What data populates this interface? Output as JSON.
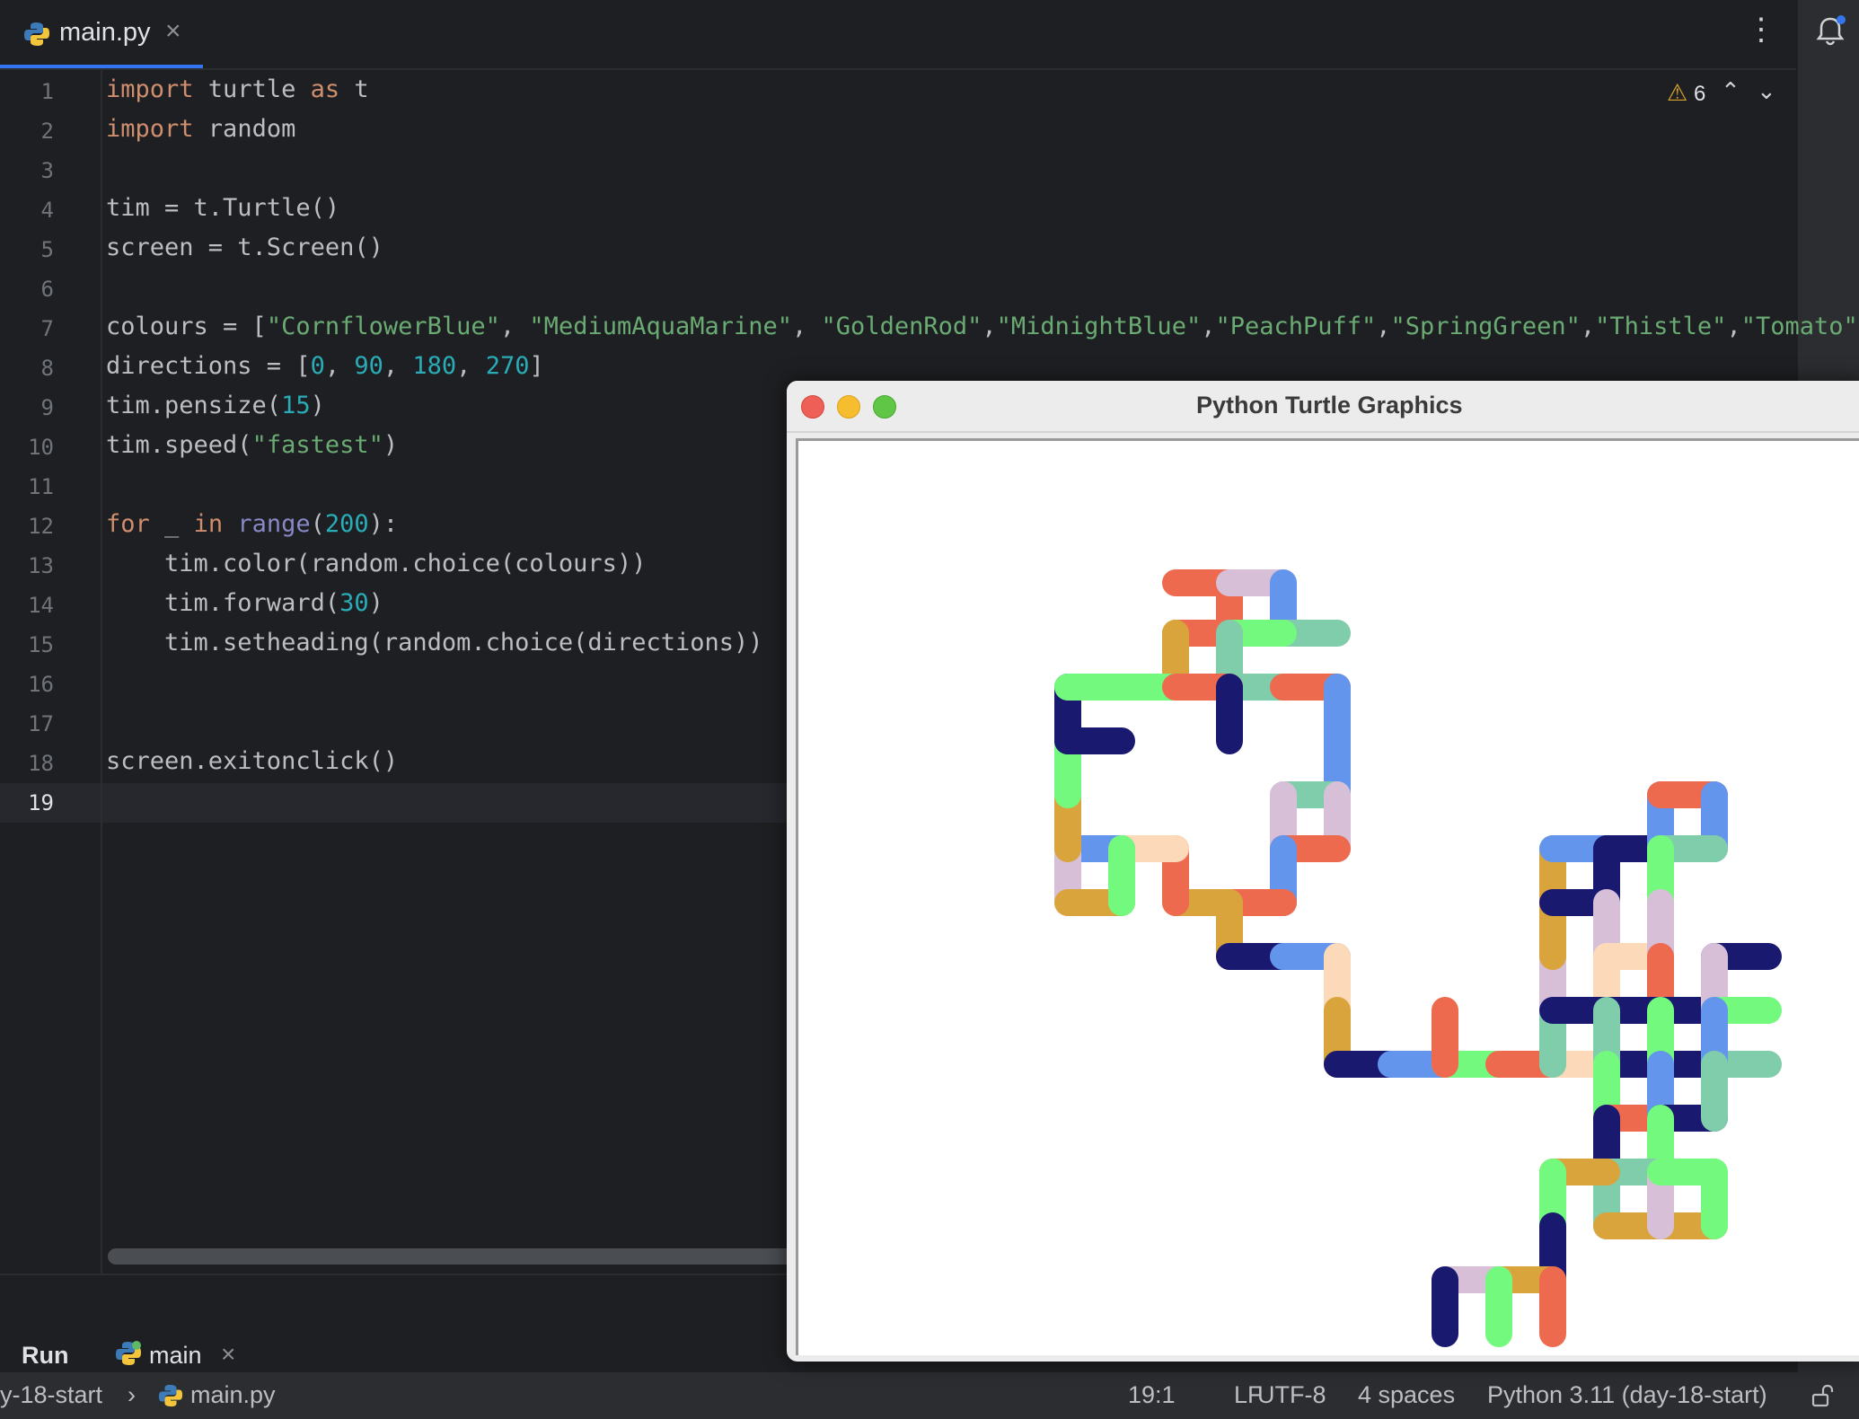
{
  "editor": {
    "tab": {
      "label": "main.py",
      "close": "×"
    },
    "more": "⋮",
    "line_numbers": [
      "1",
      "2",
      "3",
      "4",
      "5",
      "6",
      "7",
      "8",
      "9",
      "10",
      "11",
      "12",
      "13",
      "14",
      "15",
      "16",
      "17",
      "18",
      "19"
    ],
    "current_line": "19",
    "inspections": {
      "count": "6",
      "icon": "warning-icon"
    },
    "code": {
      "l1_kw1": "import",
      "l1_mid": " turtle ",
      "l1_kw2": "as",
      "l1_end": " t",
      "l2_kw": "import",
      "l2_end": " random",
      "l4": "tim = t.Turtle()",
      "l5": "screen = t.Screen()",
      "l7_a": "colours = [",
      "l7_s1": "\"CornflowerBlue\"",
      "l7_c1": ", ",
      "l7_s2": "\"MediumAquaMarine\"",
      "l7_c2": ", ",
      "l7_s3": "\"GoldenRod\"",
      "l7_c3": ",",
      "l7_s4": "\"MidnightBlue\"",
      "l7_c4": ",",
      "l7_s5": "\"PeachPuff\"",
      "l7_c5": ",",
      "l7_s6": "\"SpringGreen\"",
      "l7_c6": ",",
      "l7_s7": "\"Thistle\"",
      "l7_c7": ",",
      "l7_s8": "\"Tomato\"",
      "l7_end": "]",
      "l8_a": "directions = [",
      "l8_n1": "0",
      "l8_c1": ", ",
      "l8_n2": "90",
      "l8_c2": ", ",
      "l8_n3": "180",
      "l8_c3": ", ",
      "l8_n4": "270",
      "l8_end": "]",
      "l9_a": "tim.pensize(",
      "l9_n": "15",
      "l9_end": ")",
      "l10_a": "tim.speed(",
      "l10_s": "\"fastest\"",
      "l10_end": ")",
      "l12_kw1": "for",
      "l12_mid": " _ ",
      "l12_kw2": "in",
      "l12_sp": " ",
      "l12_bi": "range",
      "l12_p": "(",
      "l12_n": "200",
      "l12_end": "):",
      "l13": "    tim.color(random.choice(colours))",
      "l14_a": "    tim.forward(",
      "l14_n": "30",
      "l14_end": ")",
      "l15": "    tim.setheading(random.choice(directions))",
      "l18": "screen.exitonclick()"
    }
  },
  "run": {
    "label": "Run",
    "tab_label": "main",
    "tab_close": "×"
  },
  "status": {
    "breadcrumb_project": "y-18-start",
    "breadcrumb_sep": "›",
    "breadcrumb_file": "main.py",
    "position": "19:1",
    "line_sep": "LF",
    "encoding": "UTF-8",
    "indent": "4 spaces",
    "interpreter": "Python 3.11 (day-18-start)"
  },
  "turtle_window": {
    "title": "Python Turtle Graphics",
    "colors": {
      "CornflowerBlue": "#6495ed",
      "MediumAquaMarine": "#7fcdaa",
      "GoldenRod": "#d9a43c",
      "MidnightBlue": "#191970",
      "PeachPuff": "#fbd9b9",
      "SpringGreen": "#73fa7e",
      "Thistle": "#d8bfd8",
      "Tomato": "#ee6a4f"
    }
  }
}
